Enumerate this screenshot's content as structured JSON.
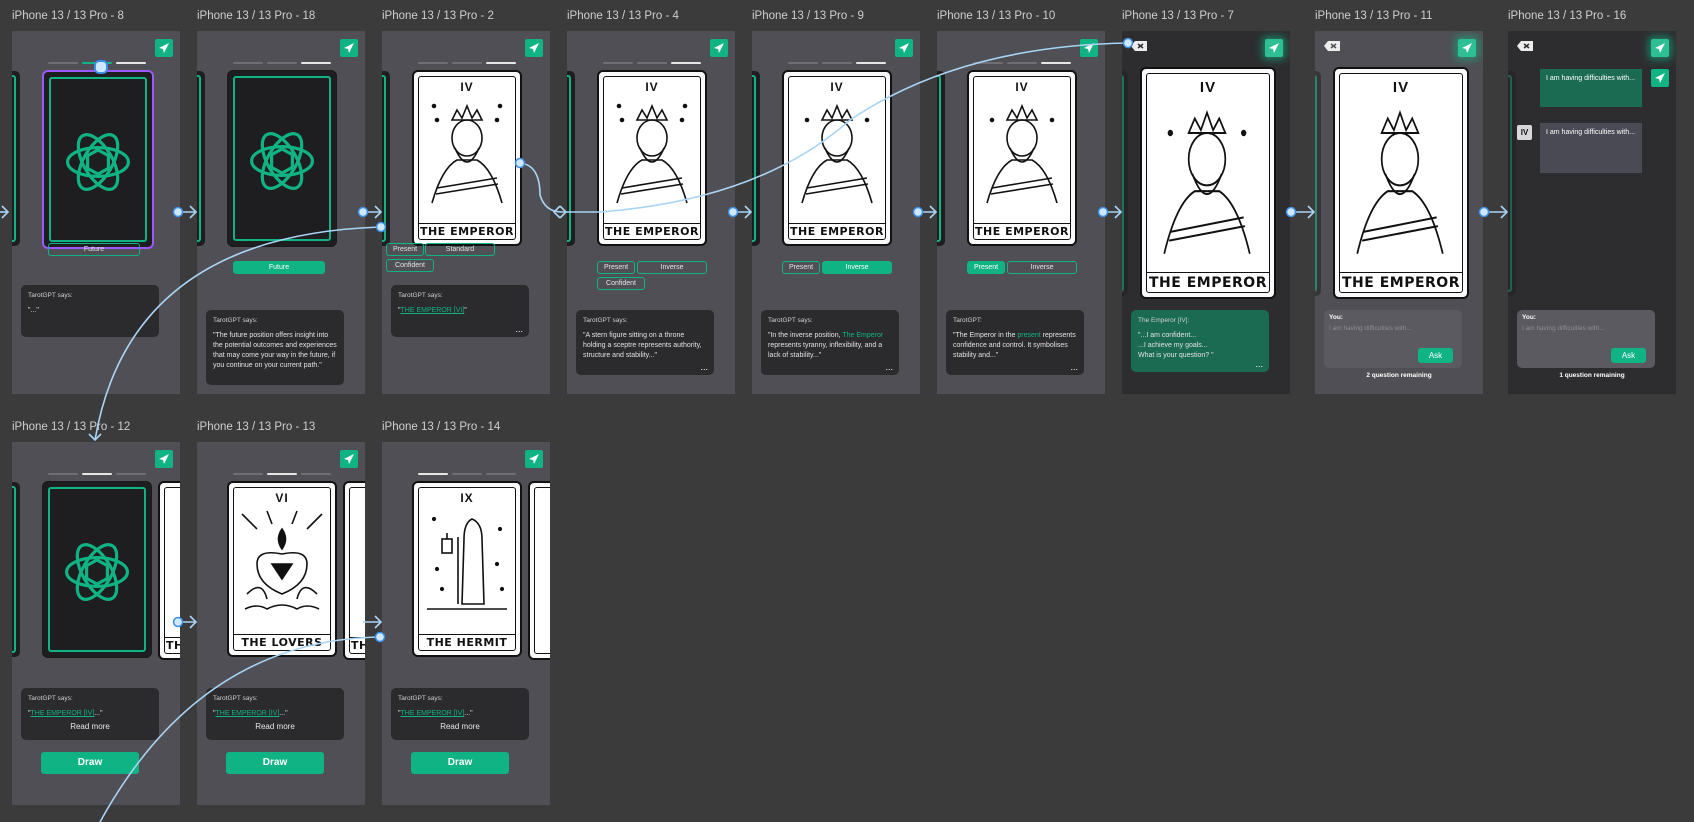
{
  "frames": [
    {
      "label": "iPhone 13 / 13 Pro - 8"
    },
    {
      "label": "iPhone 13 / 13 Pro - 18"
    },
    {
      "label": "iPhone 13 / 13 Pro - 2"
    },
    {
      "label": "iPhone 13 / 13 Pro - 4"
    },
    {
      "label": "iPhone 13 / 13 Pro - 9"
    },
    {
      "label": "iPhone 13 / 13 Pro - 10"
    },
    {
      "label": "iPhone 13 / 13 Pro - 7"
    },
    {
      "label": "iPhone 13 / 13 Pro - 11"
    },
    {
      "label": "iPhone 13 / 13 Pro - 16"
    },
    {
      "label": "iPhone 13 / 13 Pro - 12"
    },
    {
      "label": "iPhone 13 / 13 Pro - 13"
    },
    {
      "label": "iPhone 13 / 13 Pro - 14"
    }
  ],
  "cards": {
    "emperor_num": "IV",
    "emperor_name": "THE EMPEROR",
    "lovers_num": "VI",
    "lovers_name": "THE LOVERS",
    "hermit_num": "IX",
    "hermit_name": "THE HERMIT",
    "edge_name_fragment": "TH"
  },
  "chips": {
    "future": "Future",
    "present": "Present",
    "standard": "Standard",
    "confident": "Confident",
    "inverse": "Inverse"
  },
  "bubbles": {
    "says": "TarotGPT says:",
    "short_who": "TarotGPT:",
    "f8_text": "\"...\"",
    "f18_text": "\"The future position offers insight into the potential outcomes and experiences that may come your way in the future, if you continue on your current path.\"",
    "f2_open": "\"",
    "f2_link": "THE EMPEROR [VI]",
    "f2_close": "\"",
    "f4_text": "\"A stern figure sitting on a throne holding a sceptre represents authority, structure and stability...\"",
    "f9_a": "\"In the inverse position, ",
    "f9_hl": "The Emperor",
    "f9_b": " represents tyranny, inflexibility, and a lack of stability...\"",
    "f10_a": "\"The Emperor in the ",
    "f10_hl": "present",
    "f10_b": " represents confidence and control. It symbolises stability and...\"",
    "f7_who": "The Emperor [IV]:",
    "f7_l1": "\"...I am confident...",
    "f7_l2": "...I achieve my goals...",
    "f7_l3": "What is your question? \"",
    "more": "...",
    "row2_open": "\"",
    "row2_link": "THE EMPEROR [IV]",
    "row2_close": "...\"",
    "read_more": "Read more"
  },
  "ask": {
    "you": "You:",
    "placeholder": "I am having difficulties with...",
    "ask_label": "Ask",
    "remaining_2": "2 question remaining",
    "remaining_1": "1 question remaining"
  },
  "chat": {
    "msg1": "I am having difficulties with...",
    "msg2": "I am having difficulties with...",
    "iv_tag": "IV"
  },
  "draw": {
    "label": "Draw"
  },
  "colors": {
    "accent": "#10b383",
    "canvas": "#3b3b3b",
    "frame": "#4f4f55",
    "connector": "#a9d4f5"
  }
}
